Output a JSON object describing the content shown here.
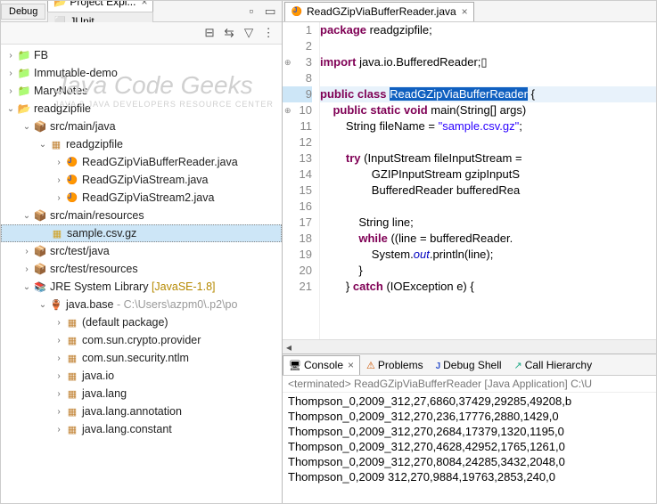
{
  "perspective": "Debug",
  "left": {
    "tabs": [
      {
        "label": "Project Expl...",
        "icon": "ico-proj-open",
        "active": true
      },
      {
        "label": "JUnit",
        "icon": "ico-junit",
        "active": false
      }
    ],
    "watermark": {
      "line1": "Java Code Geeks",
      "line2": "JAVA 2 JAVA DEVELOPERS RESOURCE CENTER"
    },
    "tree": [
      {
        "depth": 0,
        "twisty": ">",
        "icon": "ico-proj-closed",
        "label": "FB"
      },
      {
        "depth": 0,
        "twisty": ">",
        "icon": "ico-proj-closed",
        "label": "Immutable-demo"
      },
      {
        "depth": 0,
        "twisty": ">",
        "icon": "ico-proj-closed",
        "label": "MaryNotes"
      },
      {
        "depth": 0,
        "twisty": "v",
        "icon": "ico-proj-open",
        "label": "readgzipfile"
      },
      {
        "depth": 1,
        "twisty": "v",
        "icon": "ico-pkgroot",
        "label": "src/main/java"
      },
      {
        "depth": 2,
        "twisty": "v",
        "icon": "ico-pkg",
        "label": "readgzipfile"
      },
      {
        "depth": 3,
        "twisty": ">",
        "icon": "ico-java",
        "label": "ReadGZipViaBufferReader.java"
      },
      {
        "depth": 3,
        "twisty": ">",
        "icon": "ico-java",
        "label": "ReadGZipViaStream.java"
      },
      {
        "depth": 3,
        "twisty": ">",
        "icon": "ico-java",
        "label": "ReadGZipViaStream2.java"
      },
      {
        "depth": 1,
        "twisty": "v",
        "icon": "ico-pkgroot",
        "label": "src/main/resources"
      },
      {
        "depth": 2,
        "twisty": "",
        "icon": "ico-file",
        "label": "sample.csv.gz",
        "selected": true
      },
      {
        "depth": 1,
        "twisty": ">",
        "icon": "ico-pkgroot",
        "label": "src/test/java"
      },
      {
        "depth": 1,
        "twisty": ">",
        "icon": "ico-pkgroot",
        "label": "src/test/resources"
      },
      {
        "depth": 1,
        "twisty": "v",
        "icon": "ico-lib",
        "label": "JRE System Library",
        "libver": "[JavaSE-1.8]"
      },
      {
        "depth": 2,
        "twisty": "v",
        "icon": "ico-jar",
        "label": "java.base",
        "muted": " - C:\\Users\\azpm0\\.p2\\po"
      },
      {
        "depth": 3,
        "twisty": ">",
        "icon": "ico-pkg",
        "label": "(default package)"
      },
      {
        "depth": 3,
        "twisty": ">",
        "icon": "ico-pkg",
        "label": "com.sun.crypto.provider"
      },
      {
        "depth": 3,
        "twisty": ">",
        "icon": "ico-pkg",
        "label": "com.sun.security.ntlm"
      },
      {
        "depth": 3,
        "twisty": ">",
        "icon": "ico-pkg",
        "label": "java.io"
      },
      {
        "depth": 3,
        "twisty": ">",
        "icon": "ico-pkg",
        "label": "java.lang"
      },
      {
        "depth": 3,
        "twisty": ">",
        "icon": "ico-pkg",
        "label": "java.lang.annotation"
      },
      {
        "depth": 3,
        "twisty": ">",
        "icon": "ico-pkg",
        "label": "java.lang.constant"
      }
    ]
  },
  "editor": {
    "tab": {
      "label": "ReadGZipViaBufferReader.java",
      "icon": "ico-java"
    },
    "gutter": [
      "1",
      "2",
      "3",
      "8",
      "9",
      "10",
      "11",
      "12",
      "13",
      "14",
      "15",
      "16",
      "17",
      "18",
      "19",
      "20",
      "21"
    ],
    "fold_lines": [
      2,
      5
    ],
    "current_line_idx": 4,
    "lines": [
      "<span class='kw'>package</span> readgzipfile;",
      "",
      "<span class='kw'>import</span> java.io.BufferedReader;▯",
      "",
      "<span class='kw'>public</span> <span class='kw'>class</span> <span class='sel'>ReadGZipViaBufferReader</span> {",
      "    <span class='kw'>public</span> <span class='kw'>static</span> <span class='kw'>void</span> main(String[] args)",
      "        String fileName = <span class='str'>\"sample.csv.gz\"</span>;",
      "",
      "        <span class='kw'>try</span> (InputStream fileInputStream =",
      "                GZIPInputStream gzipInputS",
      "                BufferedReader bufferedRea",
      "",
      "            String line;",
      "            <span class='kw'>while</span> ((line = bufferedReader.",
      "                System.<span class='fld'>out</span>.println(line);",
      "            }",
      "        } <span class='kw'>catch</span> (IOException e) {"
    ]
  },
  "bottom": {
    "tabs": [
      {
        "label": "Console",
        "icon": "ico-console",
        "active": true,
        "closable": true
      },
      {
        "label": "Problems",
        "icon": "ico-problems"
      },
      {
        "label": "Debug Shell",
        "icon": "ico-debugshell"
      },
      {
        "label": "Call Hierarchy",
        "icon": "ico-callh"
      }
    ],
    "status": "<terminated> ReadGZipViaBufferReader [Java Application] C:\\U",
    "output": [
      "Thompson_0,2009_312,27,6860,37429,29285,49208,b",
      "Thompson_0,2009_312,270,236,17776,2880,1429,0",
      "Thompson_0,2009_312,270,2684,17379,1320,1195,0",
      "Thompson_0,2009_312,270,4628,42952,1765,1261,0",
      "Thompson_0,2009_312,270,8084,24285,3432,2048,0",
      "Thompson_0,2009 312,270,9884,19763,2853,240,0"
    ]
  }
}
